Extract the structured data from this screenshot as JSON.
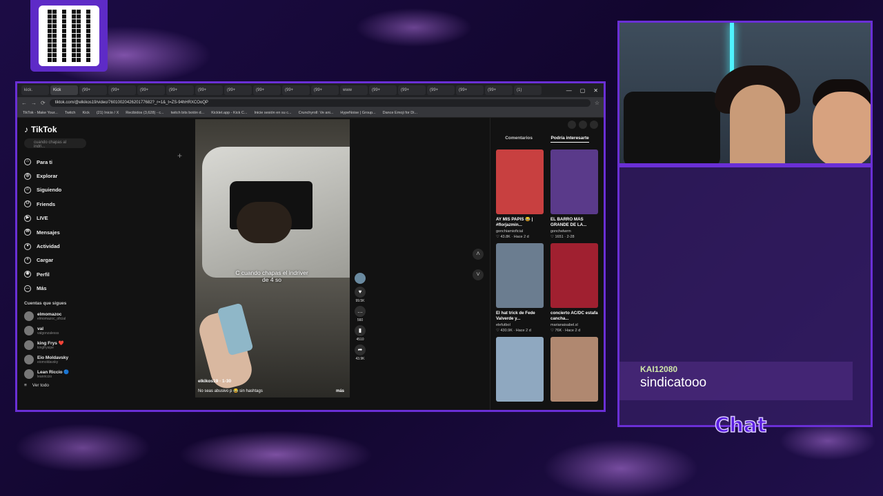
{
  "browser": {
    "tabs": [
      "kick.",
      "Kick",
      "(99+",
      "(99+",
      "(99+",
      "(99+",
      "(99+",
      "(99+",
      "(99+",
      "(99+",
      "(99+",
      "www",
      "(99+",
      "(99+",
      "(99+",
      "(99+",
      "(99+",
      "(1)"
    ],
    "url": "tiktok.com/@elkikos19/video/7601002042620177682?_r=1&_t=ZS-94hHRXCOoQP",
    "bookmarks": [
      "TikTok - Make Your...",
      "Twitch",
      "Kick",
      "(21) Inicio / X",
      "Recibidos (3,628) - c...",
      "twitch bits botón d...",
      "Kicklet.app - Kick C...",
      "Inicie sesión en su c...",
      "Crunchyroll: Ve ani...",
      "HypeNoise | Group...",
      "Dance Emoji for Di..."
    ]
  },
  "tiktok": {
    "logo": "TikTok",
    "search_placeholder": "cuando chapas al indri...",
    "nav": [
      {
        "label": "Para ti",
        "icon": "home-icon"
      },
      {
        "label": "Explorar",
        "icon": "compass-icon"
      },
      {
        "label": "Siguiendo",
        "icon": "following-icon"
      },
      {
        "label": "Friends",
        "icon": "friends-icon"
      },
      {
        "label": "LIVE",
        "icon": "live-icon"
      },
      {
        "label": "Mensajes",
        "icon": "message-icon"
      },
      {
        "label": "Actividad",
        "icon": "activity-icon"
      },
      {
        "label": "Cargar",
        "icon": "upload-icon"
      },
      {
        "label": "Perfil",
        "icon": "profile-icon"
      },
      {
        "label": "Más",
        "icon": "more-icon"
      }
    ],
    "following_header": "Cuentas que sigues",
    "following": [
      {
        "name": "elmomazoc",
        "handle": "elmomazoc_oficial"
      },
      {
        "name": "val",
        "handle": "valgonzalesss"
      },
      {
        "name": "king Frys ❤️",
        "handle": "kingfrysipe"
      },
      {
        "name": "Eio Moldavsky",
        "handle": "eiomoldavsky"
      },
      {
        "name": "Lean Riccio 🔵",
        "handle": "leanriccio"
      }
    ],
    "see_all": "Ver todo",
    "video": {
      "caption": "C cuando chapas el indriver de 4 so",
      "author": "elkikos19 · 1-30",
      "description": "No seas abusivo p 😂 sin hashtags",
      "more": "más"
    },
    "actions": [
      {
        "icon": "heart-icon",
        "count": "99.5K"
      },
      {
        "icon": "comment-icon",
        "count": "560"
      },
      {
        "icon": "bookmark-icon",
        "count": "4510"
      },
      {
        "icon": "share-icon",
        "count": "43.9K"
      }
    ],
    "right_tabs": [
      "Comentarios",
      "Podría interesarte"
    ],
    "recommendations": [
      {
        "title": "AY MIS PAPIS 😂 | #florjazmin...",
        "author": "gonchiamioficial",
        "meta": "♡ 43.8K · Hace 2 d",
        "color": "#c84040"
      },
      {
        "title": "EL BARRO MÁS GRANDE DE LA...",
        "author": "gonchelwrm",
        "meta": "♡ 1651 · 2-28",
        "color": "#5a3a8a"
      },
      {
        "title": "El hat trick de Fede Valverde y...",
        "author": "elefutbol",
        "meta": "♡ 430.9K · Hace 2 d",
        "color": "#6b7d90"
      },
      {
        "title": "concierto AC/DC estafa cancha...",
        "author": "marianaisabel.sl",
        "meta": "♡ 76K · Hace 2 d",
        "color": "#a02030"
      },
      {
        "title": "",
        "author": "",
        "meta": "",
        "color": "#8fa8c0"
      },
      {
        "title": "",
        "author": "",
        "meta": "",
        "color": "#b08870"
      }
    ]
  },
  "overlay": {
    "chat_user": "KAI12080",
    "chat_message": "sindicatooo",
    "chat_label": "Chat"
  }
}
